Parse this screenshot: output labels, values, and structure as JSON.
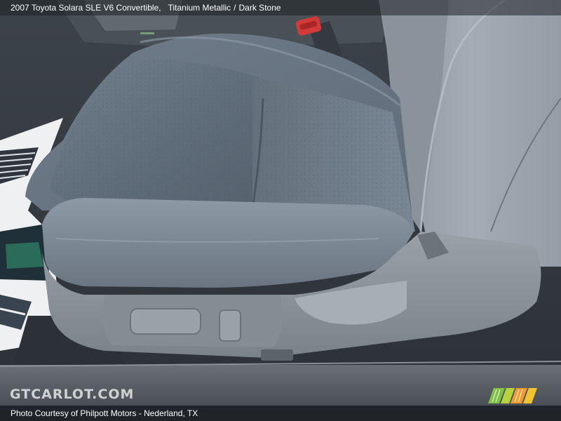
{
  "header": {
    "vehicle": "2007 Toyota Solara SLE V6 Convertible",
    "separator": ",",
    "exterior_color": "Titanium Metallic",
    "slash": "/",
    "interior_color": "Dark Stone"
  },
  "footer": {
    "credit": "Photo Courtesy of Philpott Motors - Nederland, TX"
  },
  "watermark": {
    "logo_text": "GTCARLOT.COM"
  },
  "colors": {
    "leather": "#7a8896",
    "trim": "#8f969d",
    "buckle": "#d23a3a",
    "logo_stripes": [
      "#7dc242",
      "#b6d23c",
      "#f2c230",
      "#f29a2e"
    ]
  }
}
